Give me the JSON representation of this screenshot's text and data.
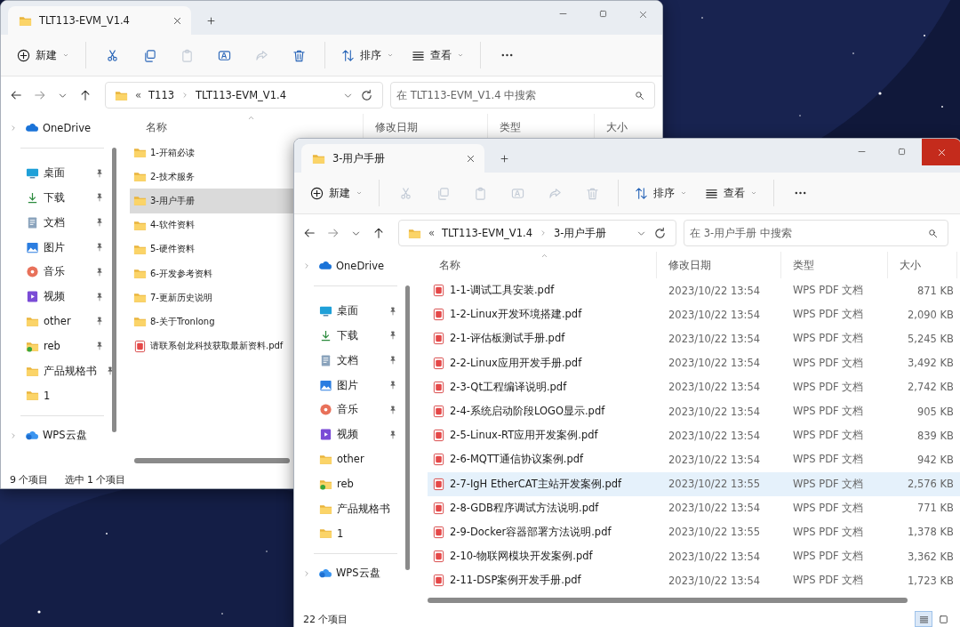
{
  "windows": [
    {
      "active": false,
      "title": "TLT113-EVM_V1.4",
      "toolbar": {
        "new": "新建",
        "sort": "排序",
        "view": "查看",
        "actions": [
          {
            "kind": "cut",
            "disabled": false
          },
          {
            "kind": "copy",
            "disabled": false
          },
          {
            "kind": "paste",
            "disabled": true
          },
          {
            "kind": "rename",
            "disabled": false
          },
          {
            "kind": "share",
            "disabled": true
          },
          {
            "kind": "delete",
            "disabled": false
          }
        ]
      },
      "address": {
        "overflow": "«",
        "crumbs": [
          "T113",
          "TLT113-EVM_V1.4"
        ]
      },
      "search": {
        "placeholder": "在 TLT113-EVM_V1.4 中搜索"
      },
      "nav": {
        "top": [
          {
            "label": "OneDrive",
            "kind": "onedrive"
          }
        ],
        "quick": [
          {
            "label": "桌面",
            "kind": "desktop",
            "pinned": true
          },
          {
            "label": "下载",
            "kind": "download",
            "pinned": true
          },
          {
            "label": "文档",
            "kind": "documents",
            "pinned": true
          },
          {
            "label": "图片",
            "kind": "pictures",
            "pinned": true
          },
          {
            "label": "音乐",
            "kind": "music",
            "pinned": true
          },
          {
            "label": "视频",
            "kind": "video",
            "pinned": true
          },
          {
            "label": "other",
            "kind": "folder",
            "pinned": true
          },
          {
            "label": "reb",
            "kind": "folder-badge",
            "pinned": true
          },
          {
            "label": "产品规格书",
            "kind": "folder",
            "pinned": true
          },
          {
            "label": "1",
            "kind": "folder",
            "pinned": false
          }
        ],
        "bottom": [
          {
            "label": "WPS云盘",
            "kind": "cloud"
          }
        ]
      },
      "columns": [
        "名称",
        "修改日期",
        "类型",
        "大小"
      ],
      "rows": [
        {
          "name": "1-开箱必读",
          "kind": "folder",
          "selected": false
        },
        {
          "name": "2-技术服务",
          "kind": "folder",
          "selected": false
        },
        {
          "name": "3-用户手册",
          "kind": "folder",
          "selected": true
        },
        {
          "name": "4-软件资料",
          "kind": "folder",
          "selected": false
        },
        {
          "name": "5-硬件资料",
          "kind": "folder",
          "selected": false
        },
        {
          "name": "6-开发参考资料",
          "kind": "folder",
          "selected": false
        },
        {
          "name": "7-更新历史说明",
          "kind": "folder",
          "selected": false
        },
        {
          "name": "8-关于Tronlong",
          "kind": "folder",
          "selected": false
        },
        {
          "name": "请联系创龙科技获取最新资料.pdf",
          "kind": "pdf",
          "selected": false
        }
      ],
      "status": [
        "9 个项目",
        "选中 1 个项目"
      ]
    },
    {
      "active": true,
      "title": "3-用户手册",
      "toolbar": {
        "new": "新建",
        "sort": "排序",
        "view": "查看",
        "actions": [
          {
            "kind": "cut",
            "disabled": true
          },
          {
            "kind": "copy",
            "disabled": true
          },
          {
            "kind": "paste",
            "disabled": true
          },
          {
            "kind": "rename",
            "disabled": true
          },
          {
            "kind": "share",
            "disabled": true
          },
          {
            "kind": "delete",
            "disabled": true
          }
        ]
      },
      "address": {
        "overflow": "«",
        "crumbs": [
          "TLT113-EVM_V1.4",
          "3-用户手册"
        ]
      },
      "search": {
        "placeholder": "在 3-用户手册 中搜索"
      },
      "nav": {
        "top": [
          {
            "label": "OneDrive",
            "kind": "onedrive"
          }
        ],
        "quick": [
          {
            "label": "桌面",
            "kind": "desktop",
            "pinned": true
          },
          {
            "label": "下载",
            "kind": "download",
            "pinned": true
          },
          {
            "label": "文档",
            "kind": "documents",
            "pinned": true
          },
          {
            "label": "图片",
            "kind": "pictures",
            "pinned": true
          },
          {
            "label": "音乐",
            "kind": "music",
            "pinned": true
          },
          {
            "label": "视频",
            "kind": "video",
            "pinned": true
          },
          {
            "label": "other",
            "kind": "folder",
            "pinned": false
          },
          {
            "label": "reb",
            "kind": "folder-badge",
            "pinned": false
          },
          {
            "label": "产品规格书",
            "kind": "folder",
            "pinned": false
          },
          {
            "label": "1",
            "kind": "folder",
            "pinned": false
          }
        ],
        "bottom": [
          {
            "label": "WPS云盘",
            "kind": "cloud"
          }
        ]
      },
      "columns": [
        "名称",
        "修改日期",
        "类型",
        "大小"
      ],
      "rows": [
        {
          "name": "1-1-调试工具安装.pdf",
          "kind": "pdf",
          "selected": false,
          "date": "2023/10/22 13:54",
          "type": "WPS PDF 文档",
          "size": "871 KB"
        },
        {
          "name": "1-2-Linux开发环境搭建.pdf",
          "kind": "pdf",
          "selected": false,
          "date": "2023/10/22 13:54",
          "type": "WPS PDF 文档",
          "size": "2,090 KB"
        },
        {
          "name": "2-1-评估板测试手册.pdf",
          "kind": "pdf",
          "selected": false,
          "date": "2023/10/22 13:54",
          "type": "WPS PDF 文档",
          "size": "5,245 KB"
        },
        {
          "name": "2-2-Linux应用开发手册.pdf",
          "kind": "pdf",
          "selected": false,
          "date": "2023/10/22 13:54",
          "type": "WPS PDF 文档",
          "size": "3,492 KB"
        },
        {
          "name": "2-3-Qt工程编译说明.pdf",
          "kind": "pdf",
          "selected": false,
          "date": "2023/10/22 13:54",
          "type": "WPS PDF 文档",
          "size": "2,742 KB"
        },
        {
          "name": "2-4-系统启动阶段LOGO显示.pdf",
          "kind": "pdf",
          "selected": false,
          "date": "2023/10/22 13:54",
          "type": "WPS PDF 文档",
          "size": "905 KB"
        },
        {
          "name": "2-5-Linux-RT应用开发案例.pdf",
          "kind": "pdf",
          "selected": false,
          "date": "2023/10/22 13:54",
          "type": "WPS PDF 文档",
          "size": "839 KB"
        },
        {
          "name": "2-6-MQTT通信协议案例.pdf",
          "kind": "pdf",
          "selected": false,
          "date": "2023/10/22 13:54",
          "type": "WPS PDF 文档",
          "size": "942 KB"
        },
        {
          "name": "2-7-IgH EtherCAT主站开发案例.pdf",
          "kind": "pdf",
          "selected": true,
          "date": "2023/10/22 13:55",
          "type": "WPS PDF 文档",
          "size": "2,576 KB"
        },
        {
          "name": "2-8-GDB程序调试方法说明.pdf",
          "kind": "pdf",
          "selected": false,
          "date": "2023/10/22 13:54",
          "type": "WPS PDF 文档",
          "size": "771 KB"
        },
        {
          "name": "2-9-Docker容器部署方法说明.pdf",
          "kind": "pdf",
          "selected": false,
          "date": "2023/10/22 13:55",
          "type": "WPS PDF 文档",
          "size": "1,378 KB"
        },
        {
          "name": "2-10-物联网模块开发案例.pdf",
          "kind": "pdf",
          "selected": false,
          "date": "2023/10/22 13:54",
          "type": "WPS PDF 文档",
          "size": "3,362 KB"
        },
        {
          "name": "2-11-DSP案例开发手册.pdf",
          "kind": "pdf",
          "selected": false,
          "date": "2023/10/22 13:54",
          "type": "WPS PDF 文档",
          "size": "1,723 KB"
        }
      ],
      "status": [
        "22 个项目"
      ],
      "view_buttons": [
        {
          "kind": "details",
          "selected": true
        },
        {
          "kind": "tiles",
          "selected": false
        }
      ]
    }
  ]
}
